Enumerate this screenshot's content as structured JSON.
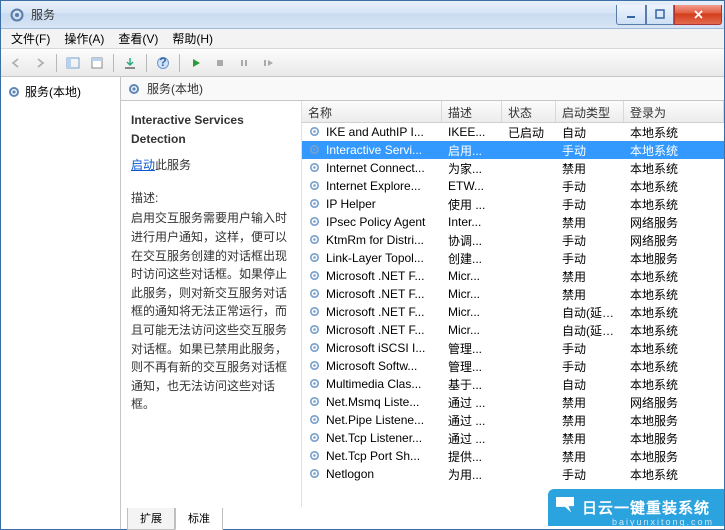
{
  "window_title": "服务",
  "menubar": {
    "file": "文件(F)",
    "action": "操作(A)",
    "view": "查看(V)",
    "help": "帮助(H)"
  },
  "tree": {
    "root_label": "服务(本地)"
  },
  "main_header": {
    "label": "服务(本地)"
  },
  "detail": {
    "title": "Interactive Services Detection",
    "start_link_prefix": "启动",
    "start_link_suffix": "此服务",
    "desc_label": "描述:",
    "desc_text": "启用交互服务需要用户输入时进行用户通知，这样，便可以在交互服务创建的对话框出现时访问这些对话框。如果停止此服务，则对新交互服务对话框的通知将无法正常运行，而且可能无法访问这些交互服务对话框。如果已禁用此服务，则不再有新的交互服务对话框通知，也无法访问这些对话框。"
  },
  "columns": {
    "name": "名称",
    "desc": "描述",
    "status": "状态",
    "start": "启动类型",
    "logon": "登录为"
  },
  "services": [
    {
      "name": "IKE and AuthIP I...",
      "desc": "IKEE...",
      "status": "已启动",
      "start": "自动",
      "logon": "本地系统"
    },
    {
      "name": "Interactive Servi...",
      "desc": "启用...",
      "status": "",
      "start": "手动",
      "logon": "本地系统",
      "selected": true
    },
    {
      "name": "Internet Connect...",
      "desc": "为家...",
      "status": "",
      "start": "禁用",
      "logon": "本地系统"
    },
    {
      "name": "Internet Explore...",
      "desc": "ETW...",
      "status": "",
      "start": "手动",
      "logon": "本地系统"
    },
    {
      "name": "IP Helper",
      "desc": "使用 ...",
      "status": "",
      "start": "手动",
      "logon": "本地系统"
    },
    {
      "name": "IPsec Policy Agent",
      "desc": "Inter...",
      "status": "",
      "start": "禁用",
      "logon": "网络服务"
    },
    {
      "name": "KtmRm for Distri...",
      "desc": "协调...",
      "status": "",
      "start": "手动",
      "logon": "网络服务"
    },
    {
      "name": "Link-Layer Topol...",
      "desc": "创建...",
      "status": "",
      "start": "手动",
      "logon": "本地服务"
    },
    {
      "name": "Microsoft .NET F...",
      "desc": "Micr...",
      "status": "",
      "start": "禁用",
      "logon": "本地系统"
    },
    {
      "name": "Microsoft .NET F...",
      "desc": "Micr...",
      "status": "",
      "start": "禁用",
      "logon": "本地系统"
    },
    {
      "name": "Microsoft .NET F...",
      "desc": "Micr...",
      "status": "",
      "start": "自动(延迟...",
      "logon": "本地系统"
    },
    {
      "name": "Microsoft .NET F...",
      "desc": "Micr...",
      "status": "",
      "start": "自动(延迟...",
      "logon": "本地系统"
    },
    {
      "name": "Microsoft iSCSI I...",
      "desc": "管理...",
      "status": "",
      "start": "手动",
      "logon": "本地系统"
    },
    {
      "name": "Microsoft Softw...",
      "desc": "管理...",
      "status": "",
      "start": "手动",
      "logon": "本地系统"
    },
    {
      "name": "Multimedia Clas...",
      "desc": "基于...",
      "status": "",
      "start": "自动",
      "logon": "本地系统"
    },
    {
      "name": "Net.Msmq Liste...",
      "desc": "通过 ...",
      "status": "",
      "start": "禁用",
      "logon": "网络服务"
    },
    {
      "name": "Net.Pipe Listene...",
      "desc": "通过 ...",
      "status": "",
      "start": "禁用",
      "logon": "本地服务"
    },
    {
      "name": "Net.Tcp Listener...",
      "desc": "通过 ...",
      "status": "",
      "start": "禁用",
      "logon": "本地服务"
    },
    {
      "name": "Net.Tcp Port Sh...",
      "desc": "提供...",
      "status": "",
      "start": "禁用",
      "logon": "本地服务"
    },
    {
      "name": "Netlogon",
      "desc": "为用...",
      "status": "",
      "start": "手动",
      "logon": "本地系统"
    }
  ],
  "tabs": {
    "extended": "扩展",
    "standard": "标准"
  },
  "watermark": {
    "text": "日云一键重装系统",
    "sub": "baiyunxitong.com"
  }
}
